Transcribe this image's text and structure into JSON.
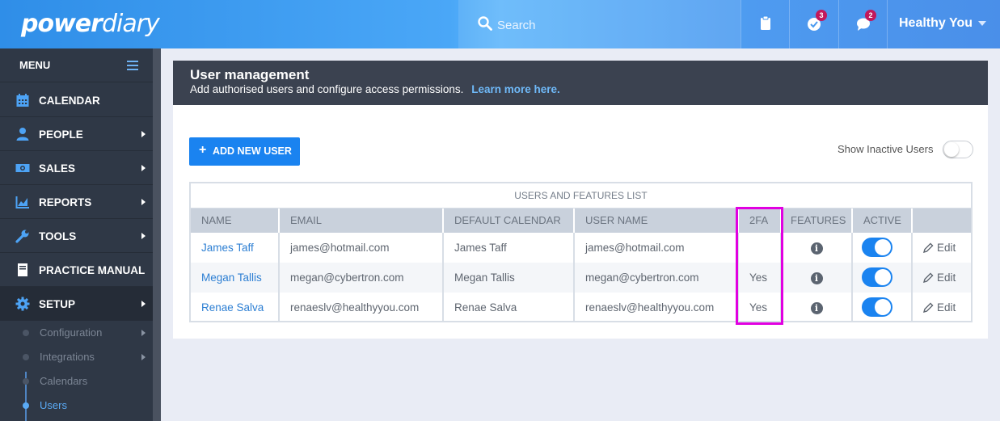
{
  "app": {
    "logo_bold": "power",
    "logo_light": "diary",
    "search_placeholder": "Search",
    "tasks_badge": "3",
    "messages_badge": "2",
    "user_name": "Healthy You"
  },
  "sidebar": {
    "menu_title": "MENU",
    "items": [
      {
        "label": "CALENDAR",
        "icon": "calendar-icon",
        "has_arrow": false
      },
      {
        "label": "PEOPLE",
        "icon": "person-icon",
        "has_arrow": true
      },
      {
        "label": "SALES",
        "icon": "money-icon",
        "has_arrow": true
      },
      {
        "label": "REPORTS",
        "icon": "chart-icon",
        "has_arrow": true
      },
      {
        "label": "TOOLS",
        "icon": "wrench-icon",
        "has_arrow": true
      },
      {
        "label": "PRACTICE MANUAL",
        "icon": "book-icon",
        "has_arrow": false
      },
      {
        "label": "SETUP",
        "icon": "gear-icon",
        "has_arrow": true,
        "active": true
      }
    ],
    "subitems": [
      {
        "label": "Configuration",
        "has_arrow": true
      },
      {
        "label": "Integrations",
        "has_arrow": true
      },
      {
        "label": "Calendars",
        "has_arrow": false
      },
      {
        "label": "Users",
        "has_arrow": false,
        "current": true
      }
    ]
  },
  "page": {
    "title": "User management",
    "subtitle": "Add authorised users and configure access permissions.",
    "learn_more": "Learn more here.",
    "add_user_label": "ADD NEW USER",
    "show_inactive_label": "Show Inactive Users",
    "show_inactive_on": false
  },
  "table": {
    "caption": "USERS AND FEATURES LIST",
    "columns": [
      "NAME",
      "EMAIL",
      "DEFAULT CALENDAR",
      "USER NAME",
      "2FA",
      "FEATURES",
      "ACTIVE",
      ""
    ],
    "rows": [
      {
        "name": "James Taff",
        "email": "james@hotmail.com",
        "calendar": "James Taff",
        "username": "james@hotmail.com",
        "twofa": "",
        "active": true,
        "edit": "Edit"
      },
      {
        "name": "Megan Tallis",
        "email": "megan@cybertron.com",
        "calendar": "Megan Tallis",
        "username": "megan@cybertron.com",
        "twofa": "Yes",
        "active": true,
        "edit": "Edit"
      },
      {
        "name": "Renae Salva",
        "email": "renaeslv@healthyyou.com",
        "calendar": "Renae Salva",
        "username": "renaeslv@healthyyou.com",
        "twofa": "Yes",
        "active": true,
        "edit": "Edit"
      }
    ]
  },
  "colors": {
    "accent": "#1a83f0",
    "sidebar": "#2f3846",
    "highlight": "#e100e1"
  }
}
